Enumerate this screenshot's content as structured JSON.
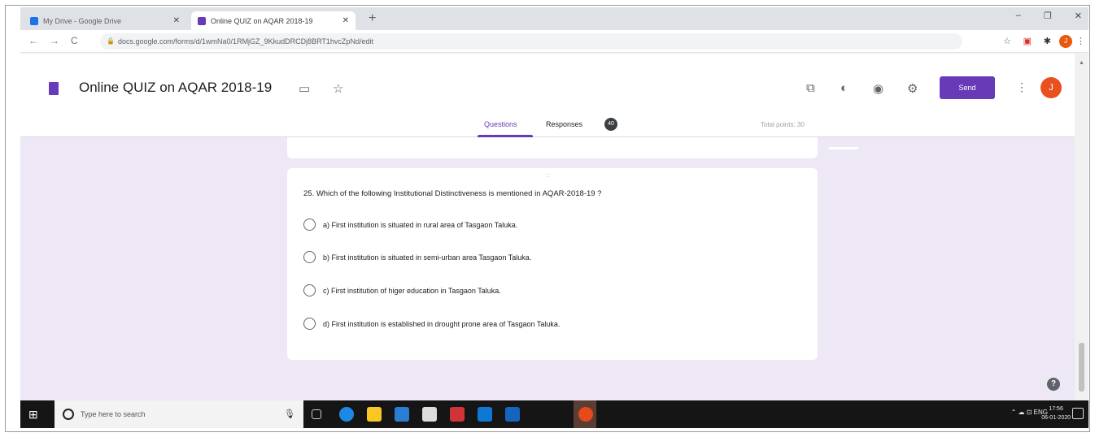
{
  "browser": {
    "tabs": [
      {
        "title": "My Drive - Google Drive",
        "active": false,
        "favicon_color": "#1a73e8"
      },
      {
        "title": "Online QUIZ on AQAR 2018-19",
        "active": true,
        "favicon_color": "#673ab7"
      }
    ],
    "new_tab": "+",
    "window": {
      "minimize": "–",
      "maximize": "❐",
      "close": "✕"
    },
    "url": "docs.google.com/forms/d/1wmNa0/1RMjGZ_9KkudDRCDj8BRT1hvcZpNd/edit",
    "nav": {
      "back": "←",
      "forward": "→",
      "reload": "C"
    },
    "profile_initial": "J"
  },
  "form": {
    "title": "Online  QUIZ on AQAR 2018-19",
    "send_label": "Send",
    "avatar_initial": "J",
    "tabs": {
      "questions": "Questions",
      "responses": "Responses",
      "responses_count": "40"
    },
    "total_points": "Total points: 30",
    "accent_color": "#673ab7"
  },
  "question": {
    "drag_handle": ":::",
    "text": "25.  Which of the following Institutional Distinctiveness is mentioned in AQAR-2018-19 ?",
    "options": [
      "a) First institution is situated in rural area of Tasgaon Taluka.",
      "b) First institution is situated in semi-urban area Tasgaon Taluka.",
      "c) First institution of higer education in Tasgaon Taluka.",
      "d) First institution is established in drought prone area of  Tasgaon Taluka."
    ]
  },
  "help": "?",
  "taskbar": {
    "search_placeholder": "Type here to search",
    "tray": "⌃ ☁ ⊡ ENG",
    "time": "17:56",
    "date": "06-01-2020"
  }
}
